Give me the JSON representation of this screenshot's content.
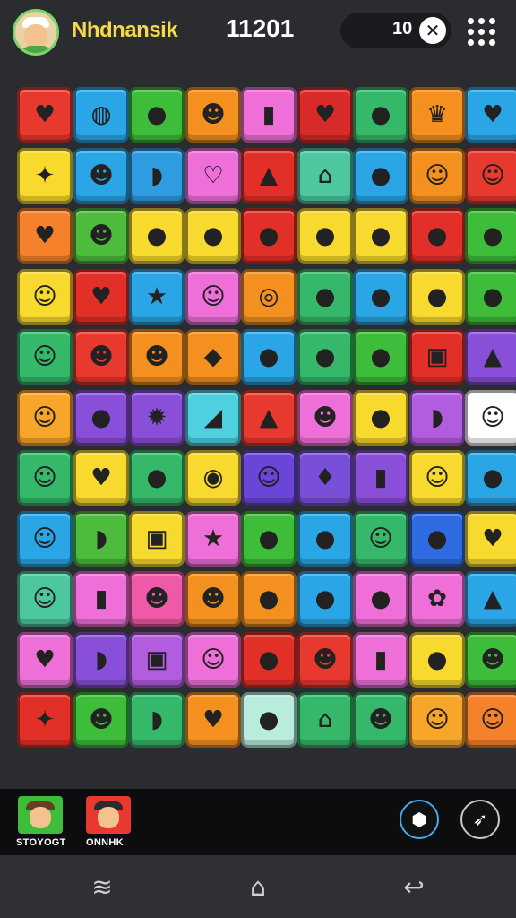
{
  "header": {
    "player_name": "Nhdnansik",
    "score": "11201",
    "moves": "10",
    "close_icon": "close-icon",
    "menu_icon": "grid-menu-icon"
  },
  "board": {
    "rows": 11,
    "cols": 9,
    "tiles": [
      [
        {
          "c": "#e8392f",
          "g": "♥"
        },
        {
          "c": "#2aa6e6",
          "g": "◍"
        },
        {
          "c": "#3dbd3a",
          "g": "●"
        },
        {
          "c": "#f3901f",
          "g": "☻"
        },
        {
          "c": "#ee6fd8",
          "g": "▮"
        },
        {
          "c": "#d92a2a",
          "g": "♥"
        },
        {
          "c": "#35b86a",
          "g": "●"
        },
        {
          "c": "#f3901f",
          "g": "♛"
        },
        {
          "c": "#2aa6e6",
          "g": "♥"
        }
      ],
      [
        {
          "c": "#f8d92e",
          "g": "✦"
        },
        {
          "c": "#2aa6e6",
          "g": "☻"
        },
        {
          "c": "#2f9be0",
          "g": "◗"
        },
        {
          "c": "#ee6fd8",
          "g": "♡"
        },
        {
          "c": "#e23028",
          "g": "▲"
        },
        {
          "c": "#4cc7a0",
          "g": "⌂"
        },
        {
          "c": "#2aa6e6",
          "g": "●"
        },
        {
          "c": "#f3901f",
          "g": "☺"
        },
        {
          "c": "#e8392f",
          "g": "☺"
        }
      ],
      [
        {
          "c": "#f5822a",
          "g": "♥"
        },
        {
          "c": "#4dbb3c",
          "g": "☻"
        },
        {
          "c": "#f8d92e",
          "g": "●"
        },
        {
          "c": "#f8d92e",
          "g": "●"
        },
        {
          "c": "#e23028",
          "g": "●"
        },
        {
          "c": "#f8d92e",
          "g": "●"
        },
        {
          "c": "#f8d92e",
          "g": "●"
        },
        {
          "c": "#e23028",
          "g": "●"
        },
        {
          "c": "#3dbd3a",
          "g": "●"
        }
      ],
      [
        {
          "c": "#f8d92e",
          "g": "☺"
        },
        {
          "c": "#e23028",
          "g": "♥"
        },
        {
          "c": "#2aa6e6",
          "g": "★"
        },
        {
          "c": "#ee6fd8",
          "g": "☺"
        },
        {
          "c": "#f3901f",
          "g": "◎"
        },
        {
          "c": "#35b86a",
          "g": "●"
        },
        {
          "c": "#2aa6e6",
          "g": "●"
        },
        {
          "c": "#f8d92e",
          "g": "●"
        },
        {
          "c": "#3dbd3a",
          "g": "●"
        }
      ],
      [
        {
          "c": "#35b86a",
          "g": "☺"
        },
        {
          "c": "#e8392f",
          "g": "☻"
        },
        {
          "c": "#f3901f",
          "g": "☻"
        },
        {
          "c": "#f3901f",
          "g": "◆"
        },
        {
          "c": "#2aa6e6",
          "g": "●"
        },
        {
          "c": "#35b86a",
          "g": "●"
        },
        {
          "c": "#3dbd3a",
          "g": "●"
        },
        {
          "c": "#e23028",
          "g": "▣"
        },
        {
          "c": "#8a4fd8",
          "g": "▲"
        }
      ],
      [
        {
          "c": "#f8a62a",
          "g": "☺"
        },
        {
          "c": "#8a4fd8",
          "g": "●"
        },
        {
          "c": "#8a4fd8",
          "g": "✹"
        },
        {
          "c": "#4fd0e0",
          "g": "◢"
        },
        {
          "c": "#e8392f",
          "g": "▲"
        },
        {
          "c": "#ee6fd8",
          "g": "☻"
        },
        {
          "c": "#f8d92e",
          "g": "●"
        },
        {
          "c": "#b25ce0",
          "g": "◗"
        },
        {
          "c": "#ffffff",
          "g": "☺"
        }
      ],
      [
        {
          "c": "#35b86a",
          "g": "☺"
        },
        {
          "c": "#f8d92e",
          "g": "♥"
        },
        {
          "c": "#35b86a",
          "g": "●"
        },
        {
          "c": "#f8d92e",
          "g": "◉"
        },
        {
          "c": "#6a45d8",
          "g": "☺"
        },
        {
          "c": "#7a4fd8",
          "g": "♦"
        },
        {
          "c": "#8a4fd8",
          "g": "▮"
        },
        {
          "c": "#f8d92e",
          "g": "☺"
        },
        {
          "c": "#2aa6e6",
          "g": "●"
        }
      ],
      [
        {
          "c": "#2aa6e6",
          "g": "☺"
        },
        {
          "c": "#4dbb3c",
          "g": "◗"
        },
        {
          "c": "#f8d92e",
          "g": "▣"
        },
        {
          "c": "#ee6fd8",
          "g": "★"
        },
        {
          "c": "#3dbd3a",
          "g": "●"
        },
        {
          "c": "#2aa6e6",
          "g": "●"
        },
        {
          "c": "#35b86a",
          "g": "☺"
        },
        {
          "c": "#2f6be0",
          "g": "●"
        },
        {
          "c": "#f8d92e",
          "g": "♥"
        }
      ],
      [
        {
          "c": "#4cc7a0",
          "g": "☺"
        },
        {
          "c": "#ee6fd8",
          "g": "▮"
        },
        {
          "c": "#ee5aa8",
          "g": "☻"
        },
        {
          "c": "#f3901f",
          "g": "☻"
        },
        {
          "c": "#f3901f",
          "g": "●"
        },
        {
          "c": "#2aa6e6",
          "g": "●"
        },
        {
          "c": "#ee6fd8",
          "g": "●"
        },
        {
          "c": "#ee6fd8",
          "g": "✿"
        },
        {
          "c": "#2aa6e6",
          "g": "▲"
        }
      ],
      [
        {
          "c": "#ee6fd8",
          "g": "♥"
        },
        {
          "c": "#8a4fd8",
          "g": "◗"
        },
        {
          "c": "#b25ce0",
          "g": "▣"
        },
        {
          "c": "#ee6fd8",
          "g": "☺"
        },
        {
          "c": "#e23028",
          "g": "●"
        },
        {
          "c": "#e8392f",
          "g": "☻"
        },
        {
          "c": "#ee6fd8",
          "g": "▮"
        },
        {
          "c": "#f8d92e",
          "g": "●"
        },
        {
          "c": "#3dbd3a",
          "g": "☻"
        }
      ],
      [
        {
          "c": "#e23028",
          "g": "✦"
        },
        {
          "c": "#3dbd3a",
          "g": "☻"
        },
        {
          "c": "#35b86a",
          "g": "◗"
        },
        {
          "c": "#f3901f",
          "g": "♥"
        },
        {
          "c": "#b8ecdc",
          "g": "●"
        },
        {
          "c": "#35b86a",
          "g": "⌂"
        },
        {
          "c": "#35b86a",
          "g": "☻"
        },
        {
          "c": "#f8a62a",
          "g": "☺"
        },
        {
          "c": "#f5822a",
          "g": "☺"
        }
      ]
    ]
  },
  "bottom": {
    "characters": [
      {
        "label": "STOYOGT",
        "bg": "#3dbd3a"
      },
      {
        "label": "ONNHK",
        "bg": "#e8392f"
      }
    ],
    "buttons": [
      {
        "name": "shield-button",
        "icon": "shield-icon"
      },
      {
        "name": "bird-button",
        "icon": "bird-icon"
      }
    ]
  },
  "navbar": {
    "recents_icon": "recents-icon",
    "home_icon": "home-icon",
    "back_icon": "back-icon"
  }
}
